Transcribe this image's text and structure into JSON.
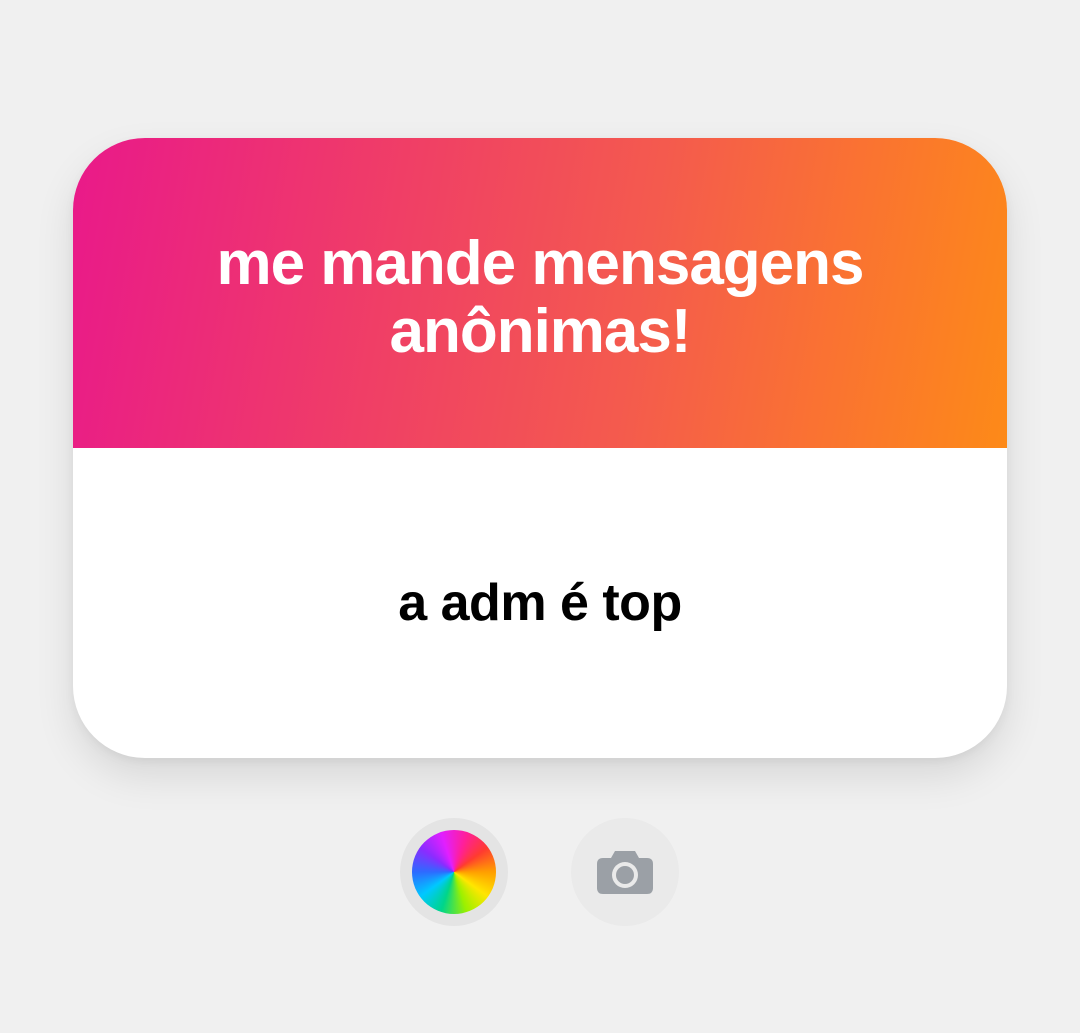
{
  "card": {
    "header_text": "me mande mensagens anônimas!",
    "answer_text": "a adm é top"
  },
  "controls": {
    "color_picker_icon": "color-wheel-icon",
    "camera_icon": "camera-icon"
  },
  "colors": {
    "background": "#f0f0f0",
    "gradient_start": "#e9198a",
    "gradient_end": "#fd8a18",
    "header_text": "#ffffff",
    "answer_text": "#000000"
  }
}
